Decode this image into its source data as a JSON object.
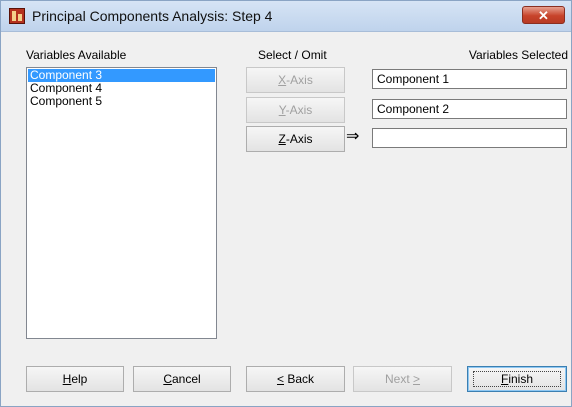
{
  "window": {
    "title": "Principal Components Analysis: Step 4",
    "close_label": "✕"
  },
  "left": {
    "header": "Variables Available",
    "items": [
      {
        "label": "Component 3",
        "selected": true
      },
      {
        "label": "Component 4",
        "selected": false
      },
      {
        "label": "Component 5",
        "selected": false
      }
    ]
  },
  "middle": {
    "header": "Select / Omit",
    "x_axis": {
      "mnemonic": "X",
      "rest": "-Axis",
      "enabled": false
    },
    "y_axis": {
      "mnemonic": "Y",
      "rest": "-Axis",
      "enabled": false
    },
    "z_axis": {
      "mnemonic": "Z",
      "rest": "-Axis",
      "enabled": true
    },
    "arrow": "⇒"
  },
  "right": {
    "header": "Variables Selected",
    "x_value": "Component 1",
    "y_value": "Component 2",
    "z_value": ""
  },
  "buttons": {
    "help": {
      "mnemonic": "H",
      "rest": "elp"
    },
    "cancel": {
      "mnemonic": "C",
      "rest": "ancel"
    },
    "back": {
      "mnemonic": "<",
      "rest": " Back"
    },
    "next": {
      "pre": "Next ",
      "mnemonic": ">"
    },
    "finish": {
      "mnemonic": "F",
      "rest": "inish"
    }
  }
}
